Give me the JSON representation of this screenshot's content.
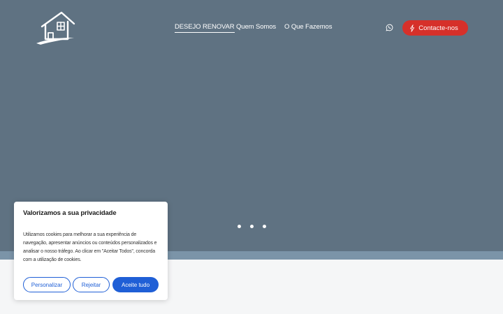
{
  "header": {
    "logo_icon": "house-logo-icon",
    "nav": [
      {
        "label": "DESEJO RENOVAR",
        "active": true
      },
      {
        "label": "Quem Somos",
        "active": false
      },
      {
        "label": "O Que Fazemos",
        "active": false
      }
    ],
    "whatsapp_icon": "whatsapp-icon",
    "contact_label": "Contacte-nos",
    "contact_icon": "lightning-icon"
  },
  "hero": {
    "slide_count": 3
  },
  "cookie_banner": {
    "title": "Valorizamos a sua privacidade",
    "text": "Utilizamos cookies para melhorar a sua experiência de navegação, apresentar anúncios ou conteúdos personalizados e analisar o nosso tráfego. Ao clicar em \"Aceitar Todos\", concorda com a utilização de cookies.",
    "customize_label": "Personalizar",
    "reject_label": "Rejeitar",
    "accept_label": "Aceite tudo"
  },
  "colors": {
    "hero_bg": "#5f7282",
    "accent_red": "#d6302a",
    "accent_blue": "#1f5fd6"
  }
}
